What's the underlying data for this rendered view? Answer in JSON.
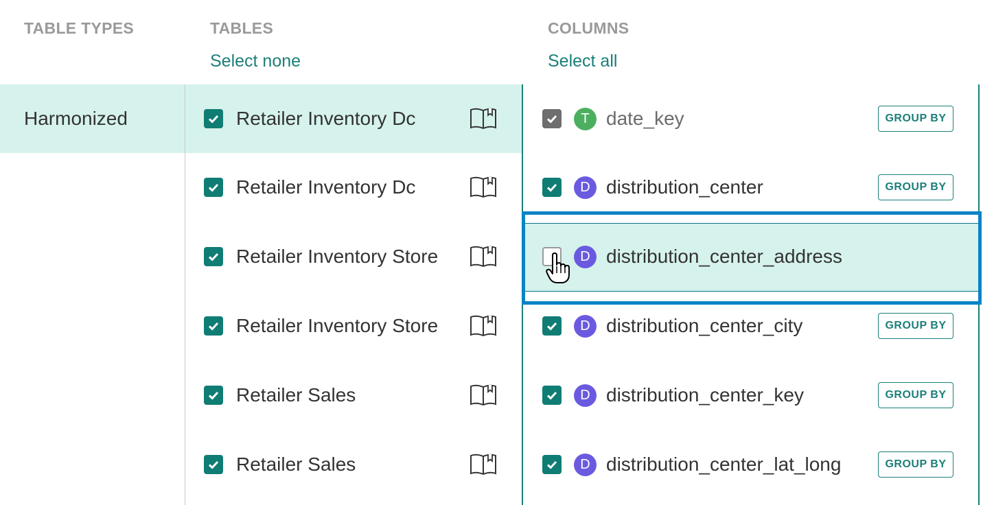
{
  "headers": {
    "table_types": "TABLE TYPES",
    "tables": "TABLES",
    "columns": "COLUMNS"
  },
  "links": {
    "tables_select": "Select none",
    "columns_select": "Select all"
  },
  "table_types": [
    {
      "label": "Harmonized",
      "selected": true
    }
  ],
  "tables": [
    {
      "label": "Retailer Inventory Dc",
      "checked": true,
      "selected": true,
      "icon": "book-icon"
    },
    {
      "label": "Retailer Inventory Dc",
      "checked": true,
      "selected": false,
      "icon": "book-icon"
    },
    {
      "label": "Retailer Inventory Store",
      "checked": true,
      "selected": false,
      "icon": "book-icon"
    },
    {
      "label": "Retailer Inventory Store",
      "checked": true,
      "selected": false,
      "icon": "book-icon"
    },
    {
      "label": "Retailer Sales",
      "checked": true,
      "selected": false,
      "icon": "book-icon"
    },
    {
      "label": "Retailer Sales",
      "checked": true,
      "selected": false,
      "icon": "book-icon"
    }
  ],
  "columns": [
    {
      "name": "date_key",
      "type": "T",
      "checked": true,
      "disabled": true,
      "group_by": "GROUP BY"
    },
    {
      "name": "distribution_center",
      "type": "D",
      "checked": true,
      "group_by": "GROUP BY"
    },
    {
      "name": "distribution_center_address",
      "type": "D",
      "checked": false,
      "hovered": true
    },
    {
      "name": "distribution_center_city",
      "type": "D",
      "checked": true,
      "group_by": "GROUP BY"
    },
    {
      "name": "distribution_center_key",
      "type": "D",
      "checked": true,
      "group_by": "GROUP BY"
    },
    {
      "name": "distribution_center_lat_long",
      "type": "D",
      "checked": true,
      "group_by": "GROUP BY"
    }
  ],
  "colors": {
    "accent": "#1a7f78",
    "selected_bg": "#d6f2ec",
    "type_t": "#4caf5f",
    "type_d": "#6a5ae0",
    "focus": "#0a84c6"
  }
}
